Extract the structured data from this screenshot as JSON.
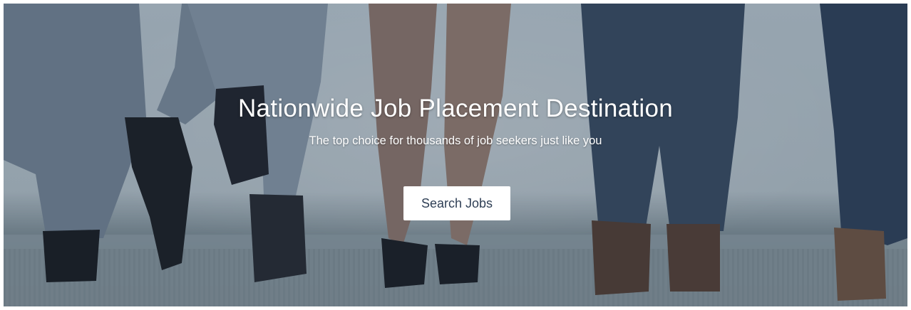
{
  "hero": {
    "title": "Nationwide Job Placement Destination",
    "subtitle": "The top choice for thousands of job seekers just like you",
    "cta_label": "Search Jobs",
    "background": "photo of people's legs and shoes standing against a wall"
  },
  "colors": {
    "button_bg": "#ffffff",
    "button_text": "#2f3f55",
    "overlay": "#14283c"
  }
}
